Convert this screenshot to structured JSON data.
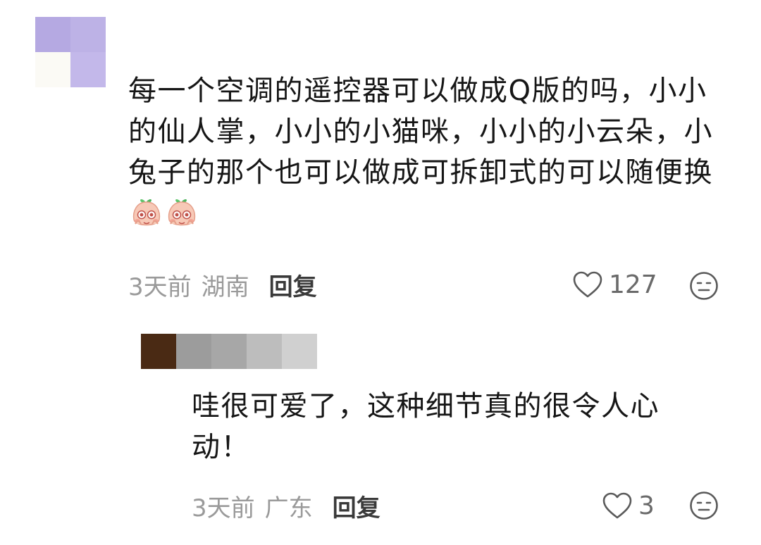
{
  "comments": [
    {
      "text": "每一个空调的遥控器可以做成Q版的吗，小小的仙人掌，小小的小猫咪，小小的小云朵，小兔子的那个也可以做成可拆卸式的可以随便换",
      "emoji": [
        "blushing-peach-emoji",
        "blushing-peach-emoji"
      ],
      "time": "3天前",
      "location": "湖南",
      "reply_label": "回复",
      "likes": "127",
      "avatar_colors": [
        "#b5a9e2",
        "#bdb2e6",
        "#fbfaf5",
        "#c3b8ea"
      ]
    },
    {
      "text": "哇很可爱了，这种细节真的很令人心动！",
      "time": "3天前",
      "location": "广东",
      "reply_label": "回复",
      "likes": "3",
      "avatar_colors": [
        "#4a2a14",
        "#9c9c9c",
        "#a7a7a7",
        "#bdbdbd",
        "#d0d0d0"
      ]
    }
  ],
  "icons": {
    "like": "heart-outline-icon",
    "dislike": "neutral-face-icon"
  }
}
